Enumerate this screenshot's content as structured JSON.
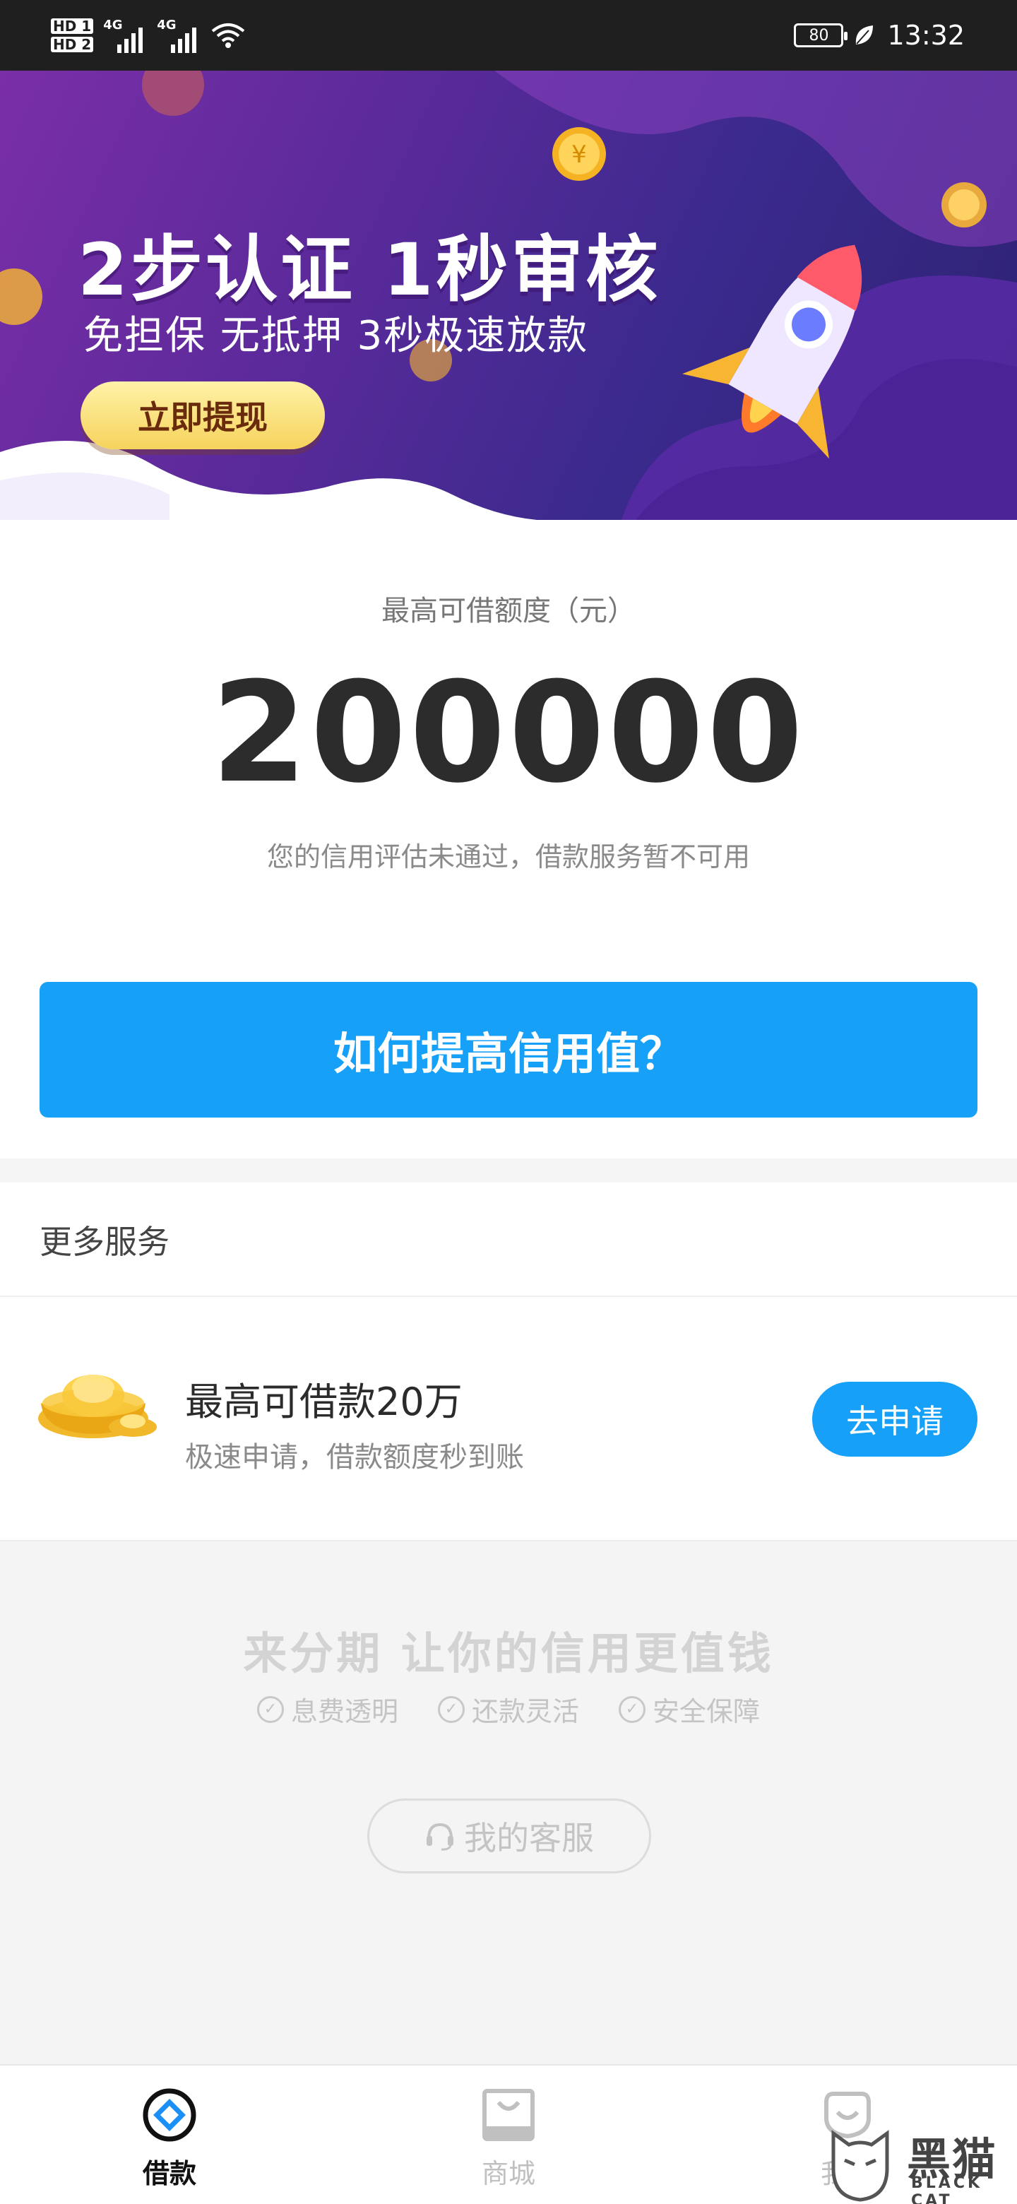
{
  "status_bar": {
    "hd1": "HD 1",
    "hd2": "HD 2",
    "net1": "4G",
    "net2": "4G",
    "battery": "80",
    "time": "13:32"
  },
  "banner": {
    "title": "2步认证  1秒审核",
    "subtitle": "免担保 无抵押 3秒极速放款",
    "cta": "立即提现",
    "background": "#5a2a9a"
  },
  "credit": {
    "label": "最高可借额度（元）",
    "amount": "200000",
    "note": "您的信用评估未通过，借款服务暂不可用",
    "improve_button": "如何提高信用值？"
  },
  "more_services": {
    "title": "更多服务",
    "item": {
      "title": "最高可借款20万",
      "desc": "极速申请，借款额度秒到账",
      "button": "去申请",
      "icon": "gold-ingot-icon"
    }
  },
  "promo": {
    "slogan": "来分期  让你的信用更值钱",
    "features": [
      "息费透明",
      "还款灵活",
      "安全保障"
    ],
    "service_button": "我的客服"
  },
  "bottom_nav": {
    "items": [
      {
        "label": "借款",
        "icon": "loan-icon",
        "active": true
      },
      {
        "label": "商城",
        "icon": "mall-icon",
        "active": false
      },
      {
        "label": "我的",
        "icon": "profile-icon",
        "active": false
      }
    ]
  },
  "watermark": {
    "text": "黑猫",
    "sub": "BLACK CAT"
  },
  "colors": {
    "accent": "#16a0f8",
    "status_bar": "#1f1f1f"
  }
}
